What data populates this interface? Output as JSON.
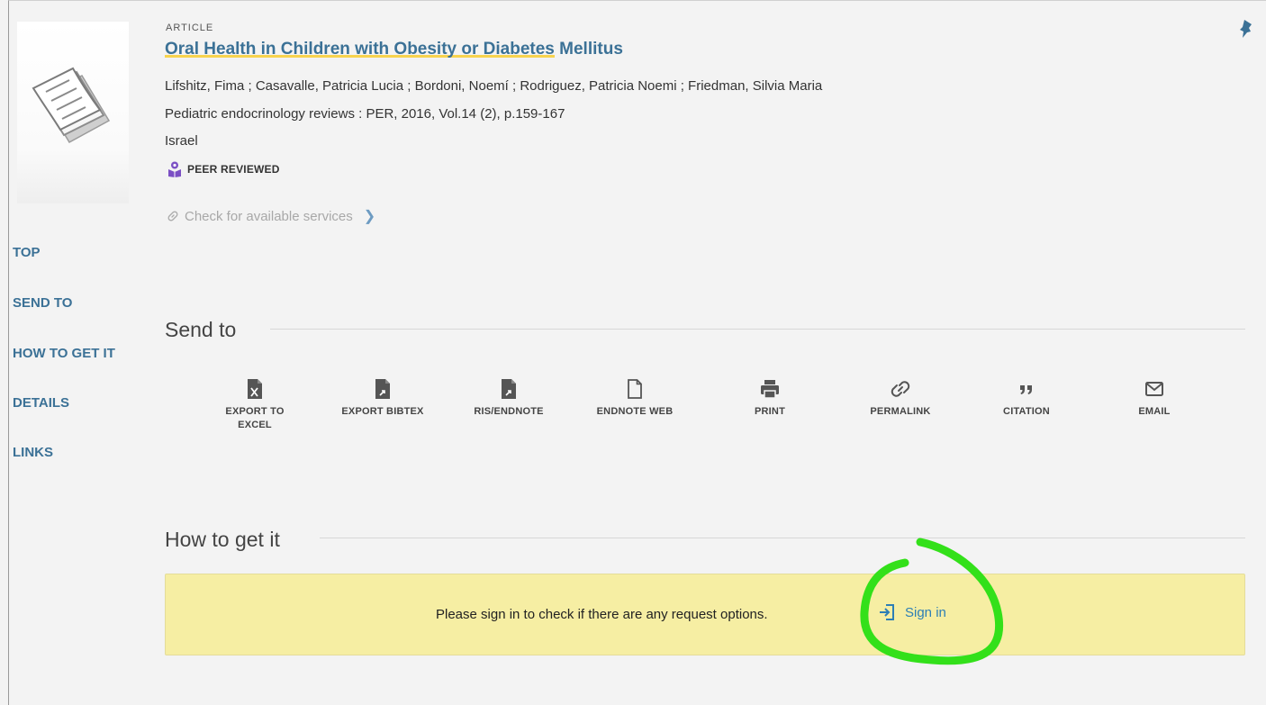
{
  "record": {
    "type": "ARTICLE",
    "title_part1": "Oral Health in Children with Obesity or Diabetes",
    "title_part2": " Mellitus",
    "authors": "Lifshitz, Fima ; Casavalle, Patricia Lucia ; Bordoni, Noemí ; Rodriguez, Patricia Noemi ; Friedman, Silvia Maria",
    "source": "Pediatric endocrinology reviews : PER, 2016, Vol.14 (2), p.159-167",
    "country": "Israel",
    "peer_reviewed": "PEER REVIEWED",
    "services_link": "Check for available services"
  },
  "sidenav": {
    "top": "TOP",
    "send_to": "SEND TO",
    "how_to_get_it": "HOW TO GET IT",
    "details": "DETAILS",
    "links": "LINKS"
  },
  "send_to": {
    "title": "Send to",
    "actions": [
      {
        "label": "EXPORT TO EXCEL",
        "icon": "excel-file-icon"
      },
      {
        "label": "EXPORT BIBTEX",
        "icon": "export-file-icon"
      },
      {
        "label": "RIS/ENDNOTE",
        "icon": "export-file-icon"
      },
      {
        "label": "ENDNOTE WEB",
        "icon": "blank-file-icon"
      },
      {
        "label": "PRINT",
        "icon": "printer-icon"
      },
      {
        "label": "PERMALINK",
        "icon": "link-icon"
      },
      {
        "label": "CITATION",
        "icon": "quote-icon"
      },
      {
        "label": "EMAIL",
        "icon": "envelope-icon"
      }
    ]
  },
  "how_to_get_it": {
    "title": "How to get it",
    "message": "Please sign in to check if there are any request options.",
    "signin_label": "Sign in"
  },
  "colors": {
    "link": "#3b7196",
    "highlight_underline": "#f8d34e",
    "notice_bg": "#f6eea3",
    "peer_badge": "#7b4fc4",
    "annotation": "#33e01a"
  }
}
